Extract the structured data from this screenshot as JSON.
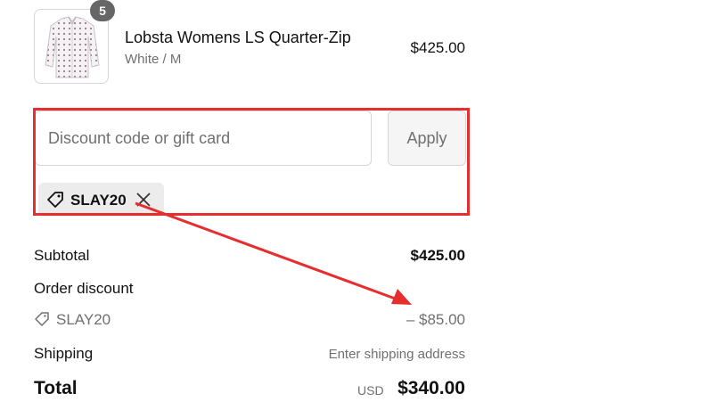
{
  "product": {
    "quantity": "5",
    "name": "Lobsta Womens LS Quarter-Zip",
    "variant": "White / M",
    "price": "$425.00"
  },
  "discount_form": {
    "placeholder": "Discount code or gift card",
    "apply_label": "Apply",
    "applied_code": "SLAY20"
  },
  "summary": {
    "subtotal_label": "Subtotal",
    "subtotal_value": "$425.00",
    "order_discount_label": "Order discount",
    "discount_code": "SLAY20",
    "discount_amount": "– $85.00",
    "shipping_label": "Shipping",
    "shipping_value": "Enter shipping address",
    "total_label": "Total",
    "total_currency": "USD",
    "total_value": "$340.00"
  },
  "colors": {
    "annotation_red": "#e62e2e",
    "muted_text": "#707070",
    "chip_background": "#ececec"
  },
  "icons": {
    "chip": "tag-icon",
    "chip_remove": "close-icon",
    "summary_code": "tag-icon"
  }
}
